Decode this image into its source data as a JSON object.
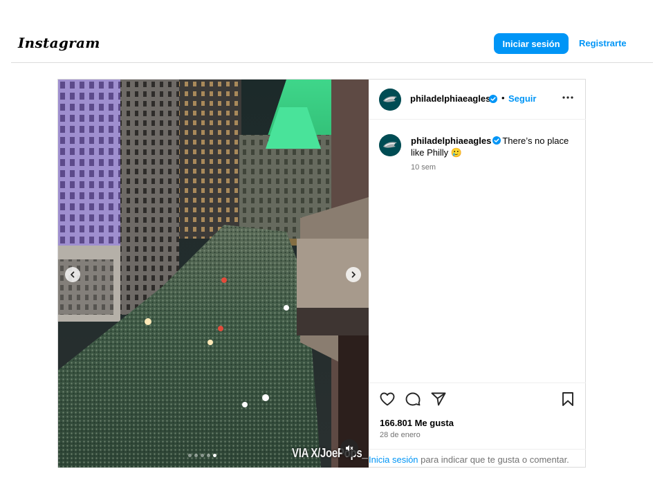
{
  "header": {
    "logo_text": "Instagram",
    "login_button": "Iniciar sesión",
    "signup_link": "Registrarte"
  },
  "post": {
    "username": "philadelphiaeagles",
    "follow_label": "Seguir",
    "separator": "•",
    "caption": "There’s no place like Philly 🥲",
    "time_ago": "10 sem",
    "likes": "166.801 Me gusta",
    "date": "28 de enero",
    "media": {
      "watermark": "VIA X/JoePops_",
      "carousel_slides": 5,
      "active_slide": 5
    },
    "login_prompt": {
      "link": "Inicia sesión",
      "text": " para indicar que te gusta o comentar."
    }
  },
  "icons": [
    "chevron-left-icon",
    "chevron-right-icon",
    "mute-icon",
    "verified-icon",
    "more-icon",
    "heart-icon",
    "comment-icon",
    "share-icon",
    "bookmark-icon"
  ],
  "colors": {
    "accent": "#0095f6",
    "border": "#dbdbdb",
    "secondary_text": "#737373",
    "verified": "#0095f6"
  }
}
